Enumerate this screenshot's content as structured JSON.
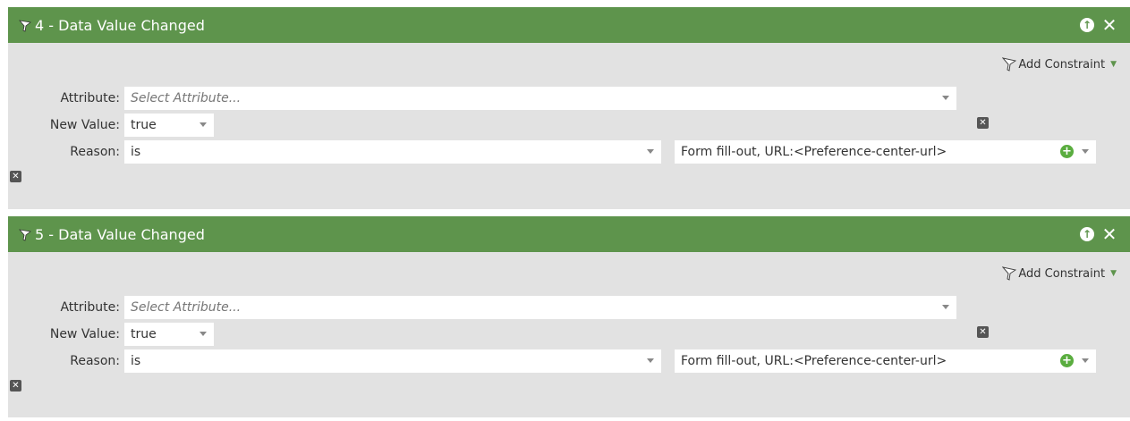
{
  "add_constraint_label": "Add Constraint",
  "labels": {
    "attribute": "Attribute:",
    "new_value": "New Value:",
    "reason": "Reason:"
  },
  "filters": [
    {
      "title": "4 - Data Value Changed",
      "attribute_placeholder": "Select Attribute...",
      "new_value": "true",
      "reason_operator": "is",
      "reason_value": "Form fill-out, URL:<Preference-center-url>"
    },
    {
      "title": "5 - Data Value Changed",
      "attribute_placeholder": "Select Attribute...",
      "new_value": "true",
      "reason_operator": "is",
      "reason_value": "Form fill-out, URL:<Preference-center-url>"
    }
  ],
  "colors": {
    "header_green": "#5e944c",
    "panel_gray": "#e2e2e2",
    "plus_green": "#5aad3f"
  },
  "icons": [
    "funnel-icon",
    "move-up-icon",
    "close-icon",
    "add-value-icon",
    "remove-icon",
    "chevron-down-icon"
  ]
}
